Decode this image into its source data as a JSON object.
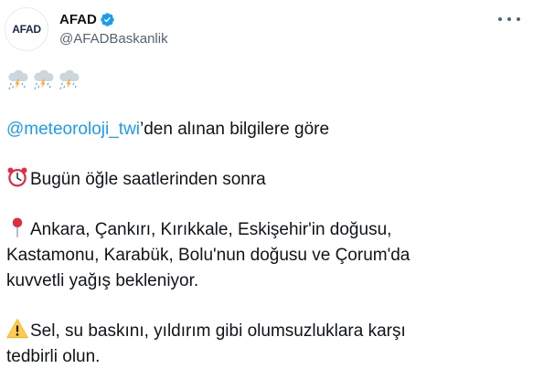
{
  "account": {
    "avatar_text": "AFAD",
    "display_name": "AFAD",
    "handle": "@AFADBaskanlik",
    "verified": true
  },
  "icons": {
    "storm": "cloud-with-lightning-and-rain-icon",
    "clock": "alarm-clock-icon",
    "pin": "round-pushpin-icon",
    "warning": "warning-icon",
    "verified": "verified-badge-icon",
    "more": "more-options-icon"
  },
  "tweet": {
    "mention": "@meteoroloji_twi",
    "line1_rest": "’den alınan bilgilere göre",
    "line2": "Bugün öğle saatlerinden sonra",
    "line3": "Ankara, Çankırı, Kırıkkale, Eskişehir'in doğusu,",
    "line4": "Kastamonu, Karabük, Bolu'nun doğusu ve Çorum'da",
    "line5": "kuvvetli yağış bekleniyor.",
    "line6": "Sel, su baskını, yıldırım gibi olumsuzluklara karşı",
    "line7": "tedbirli olun."
  },
  "colors": {
    "link": "#1d9bf0",
    "text": "#0f1419",
    "secondary": "#536471",
    "verified": "#1d9bf0"
  }
}
